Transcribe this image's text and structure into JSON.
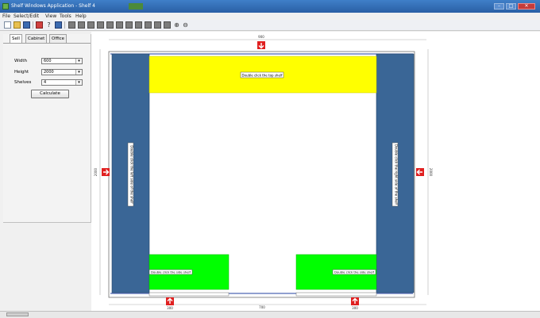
{
  "window": {
    "title": "Shelf Windows Application - Shelf 4",
    "buttons": {
      "minimize": "–",
      "maximize": "□",
      "close": "✕"
    }
  },
  "menu": [
    "File",
    "Select/Edit",
    "View",
    "Tools",
    "Help"
  ],
  "toolbar": {
    "icons": [
      "new-document-icon",
      "open-folder-icon",
      "save-icon",
      "print-icon",
      "help-icon",
      "pointer-icon",
      "layout-icon-1",
      "layout-icon-2",
      "layout-icon-3",
      "layout-icon-4",
      "layout-icon-5",
      "layout-icon-6",
      "layout-icon-7",
      "layout-icon-8",
      "layout-icon-9",
      "layout-icon-10",
      "layout-icon-11",
      "zoom-in-icon",
      "zoom-out-icon"
    ]
  },
  "panel": {
    "tabs": [
      "Sell",
      "Cabinet",
      "Office"
    ],
    "fields": [
      {
        "label": "Width",
        "value": "600"
      },
      {
        "label": "Height",
        "value": "2000"
      },
      {
        "label": "Shelves",
        "value": "4"
      }
    ],
    "calculate_label": "Calculate"
  },
  "drawing": {
    "dim_top": "900",
    "dim_left": "2000",
    "dim_right": "2000",
    "dim_bottom": "700",
    "dim_bottom_left": "300",
    "dim_bottom_right": "300",
    "top_shelf_label": "Double click the top shelf",
    "left_side_label": "Double click the left side of the shelf",
    "right_side_label": "Double click the right side of the shelf",
    "bottom_left_label": "Double click the side shelf",
    "bottom_right_label": "Double click the side shelf",
    "colors": {
      "side": "#3a6696",
      "top": "#ffff00",
      "bottom": "#00ff00",
      "marker": "#e02020"
    }
  }
}
